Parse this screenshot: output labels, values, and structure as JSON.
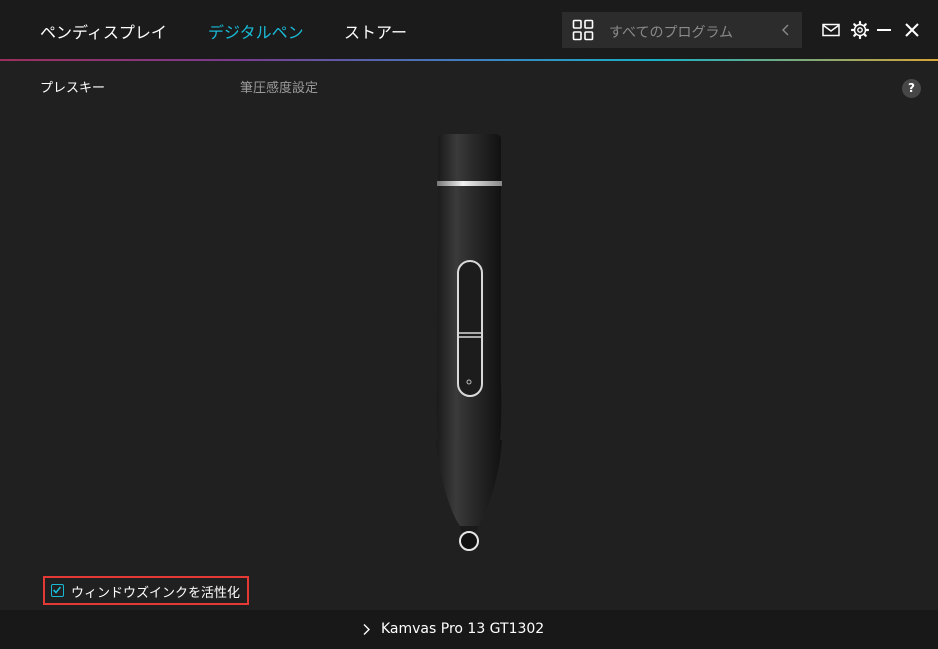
{
  "nav": {
    "tabs": [
      {
        "label": "ペンディスプレイ",
        "active": false
      },
      {
        "label": "デジタルペン",
        "active": true
      },
      {
        "label": "ストアー",
        "active": false
      }
    ]
  },
  "search": {
    "placeholder": "すべてのプログラム"
  },
  "icons": [
    "grid-icon",
    "chevron-left-icon",
    "mail-icon",
    "gear-icon",
    "minimize-icon",
    "close-icon",
    "help-icon",
    "checkbox-icon",
    "chevron-right-icon"
  ],
  "subtabs": [
    {
      "label": "プレスキー",
      "active": true
    },
    {
      "label": "筆圧感度設定",
      "active": false
    }
  ],
  "help": {
    "label": "?"
  },
  "windows_ink": {
    "label": "ウィンドウズインクを活性化",
    "checked": true
  },
  "device": {
    "name": "Kamvas Pro 13 GT1302"
  },
  "colors": {
    "accent": "#19b9d6",
    "highlight_border": "#e53935",
    "background": "#202020"
  }
}
